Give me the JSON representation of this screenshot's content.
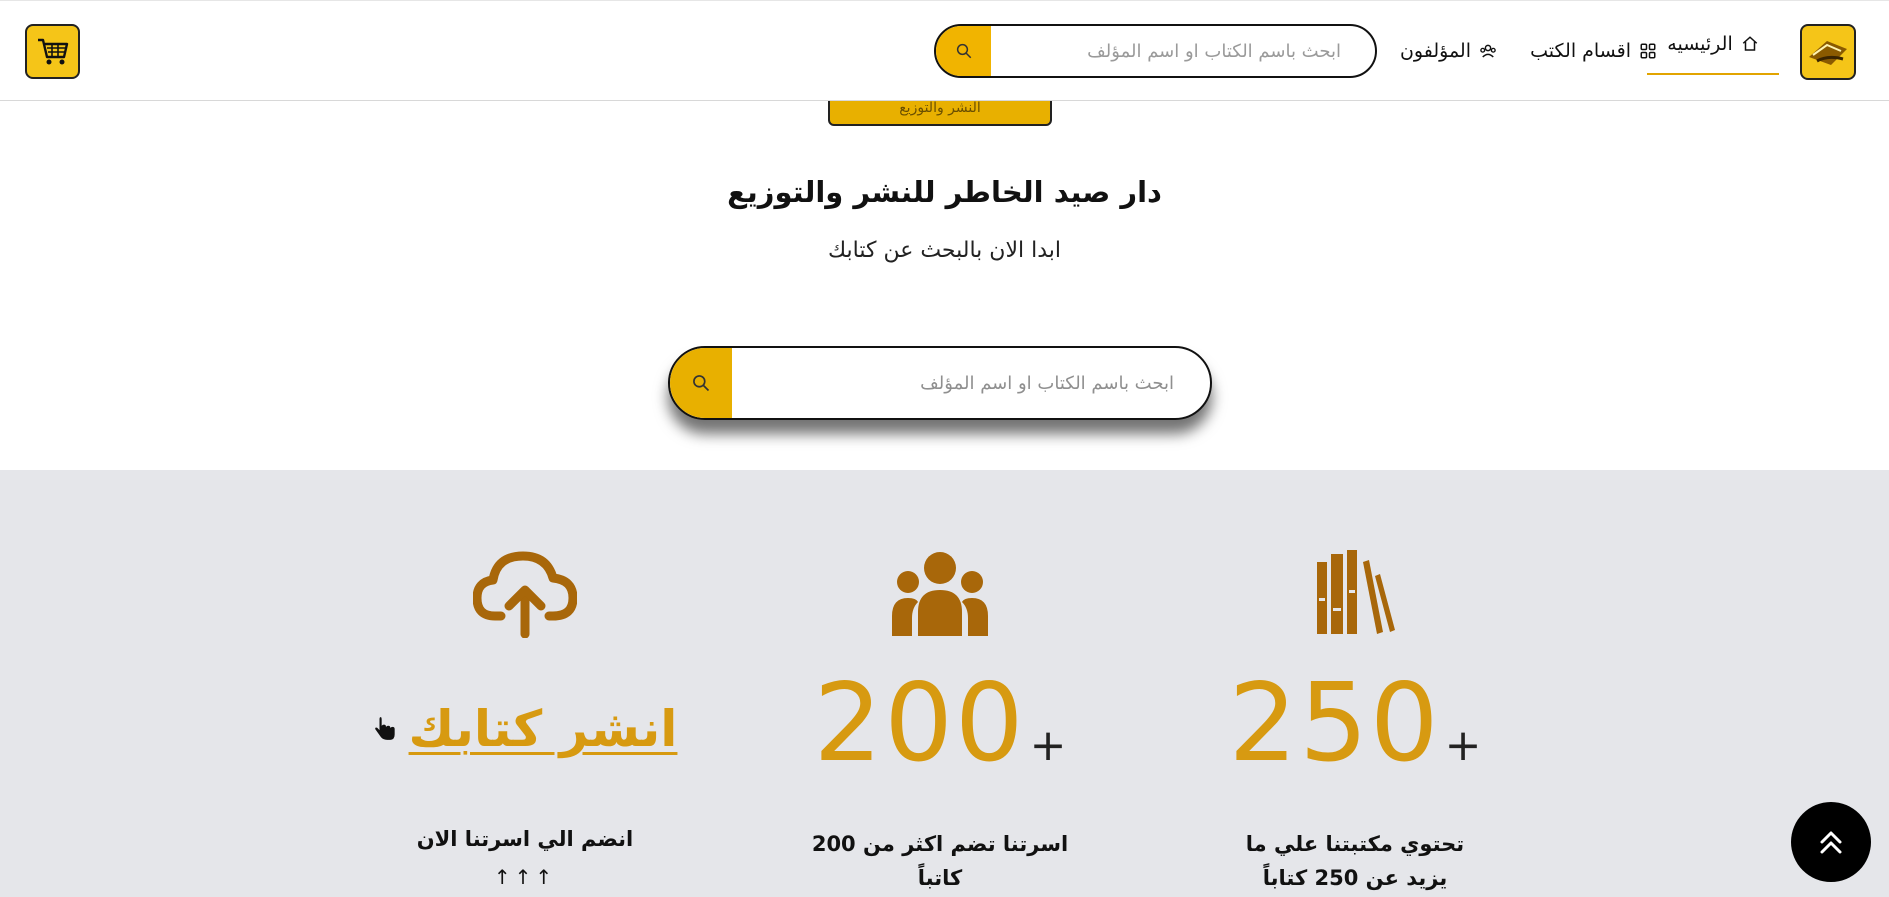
{
  "header": {
    "nav": {
      "home": "الرئيسيه",
      "categories": "اقسام الكتب",
      "authors": "المؤلفون"
    },
    "search_placeholder": "ابحث باسم الكتاب او اسم المؤلف"
  },
  "hidden_button_label": "النشر والتوزيع",
  "hero": {
    "title": "دار صيد الخاطر للنشر والتوزيع",
    "subtitle": "ابدا الان بالبحث عن كتابك",
    "search_placeholder": "ابحث باسم الكتاب او اسم المؤلف"
  },
  "stats": {
    "books": {
      "plus": "+",
      "number": "250",
      "caption_line1": "تحتوي مكتبتنا علي ما",
      "caption_line2": "يزيد عن 250 كتاباً",
      "icon": "books-icon"
    },
    "authors": {
      "plus": "+",
      "number": "200",
      "caption_line1": "اسرتنا تضم اكثر من 200",
      "caption_line2": "كاتباً",
      "icon": "users-icon"
    },
    "publish": {
      "link": "انشر كتابك",
      "caption": "انضم الي اسرتنا الان",
      "arrows": "↑↑↑",
      "icon": "cloud-upload-icon"
    }
  },
  "colors": {
    "accent": "#f1b400",
    "gold_text": "#d79a11",
    "icon_brown": "#a8670a",
    "stats_bg": "#e5e6ea"
  }
}
